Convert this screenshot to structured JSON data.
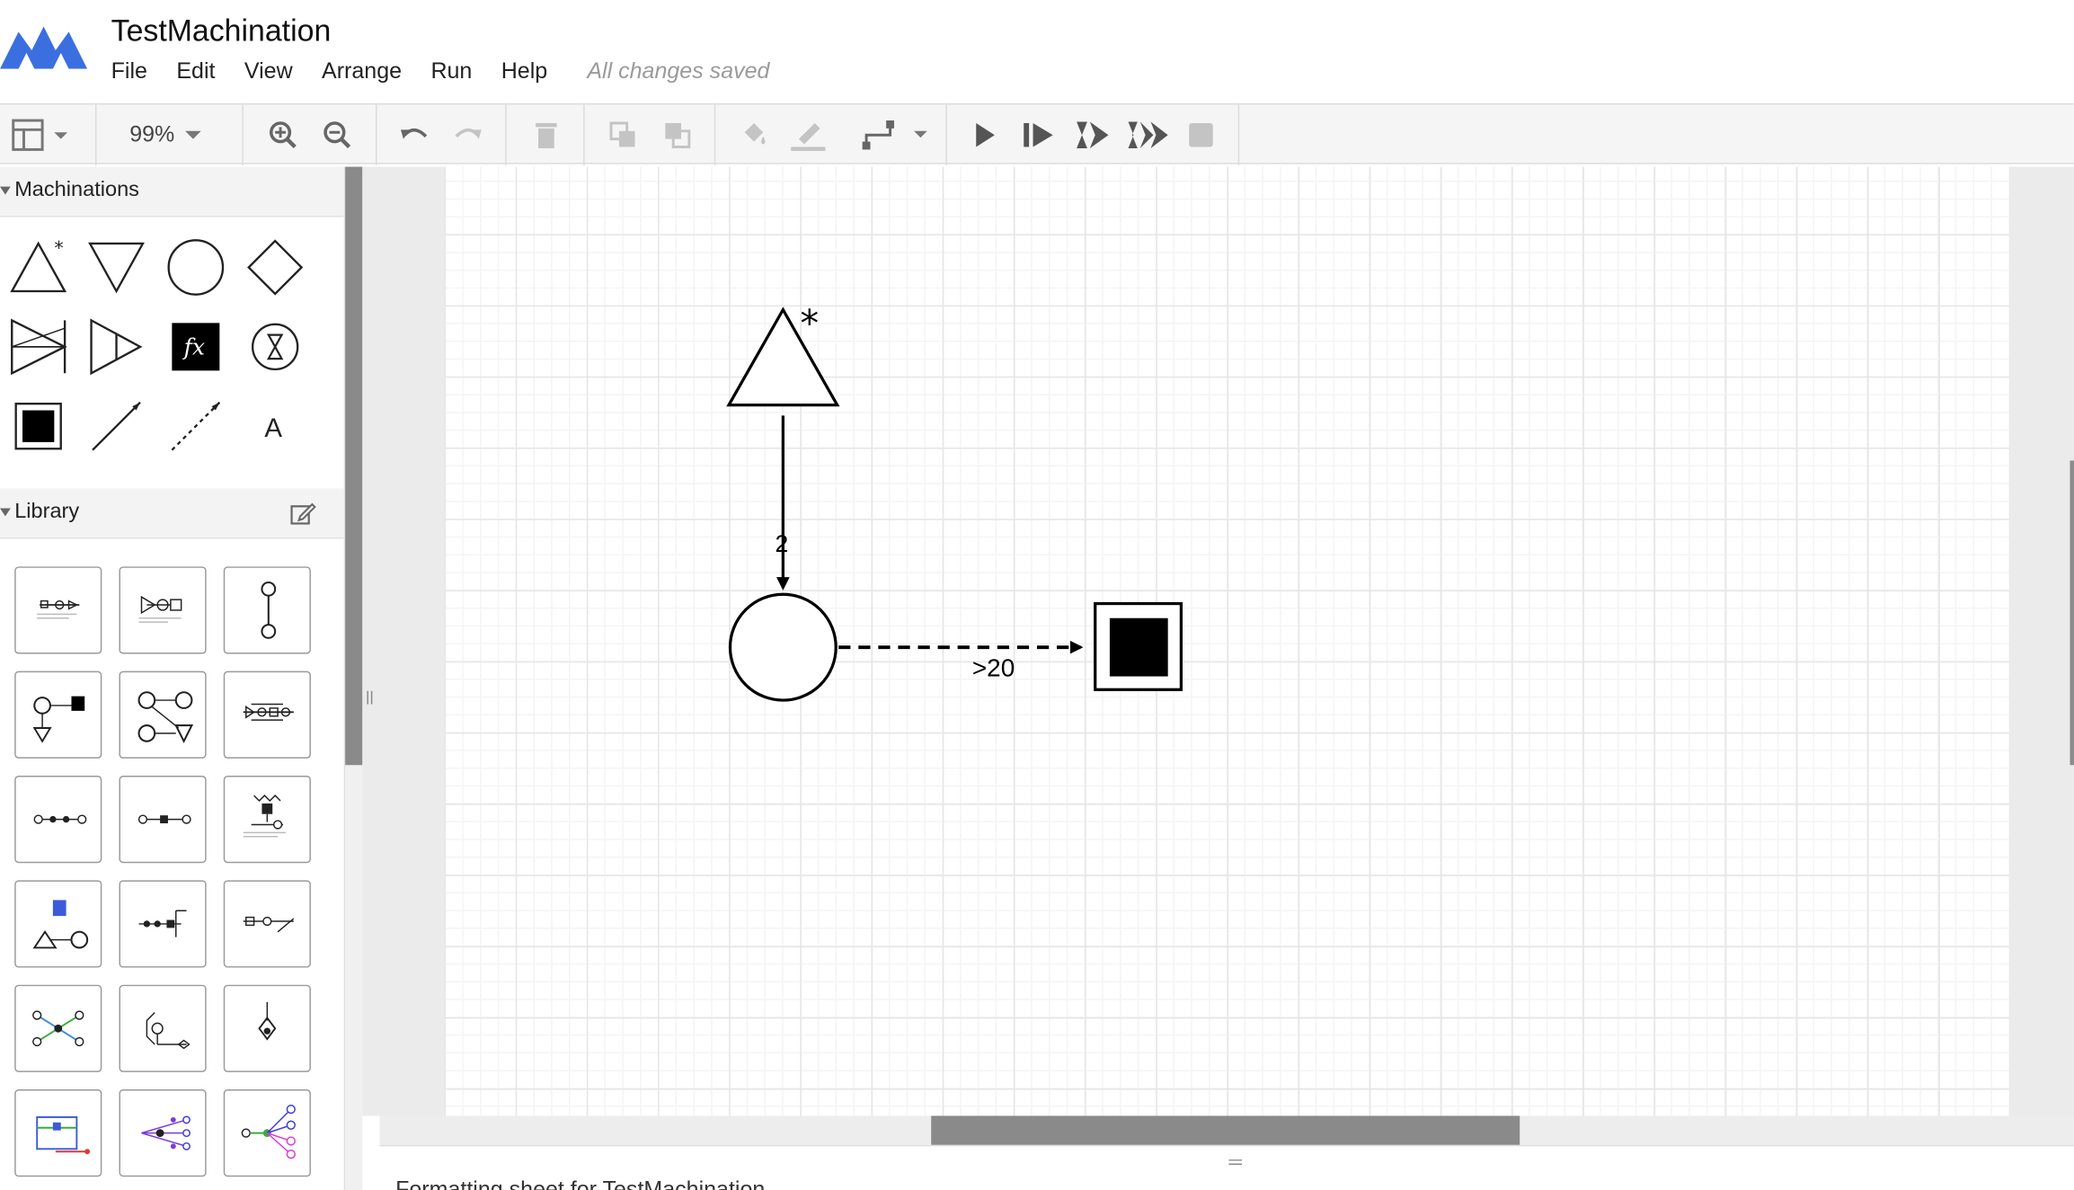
{
  "app": {
    "title": "TestMachination",
    "logo_icon": "machinations-logo-icon",
    "saved_status": "All changes saved"
  },
  "menu": [
    "File",
    "Edit",
    "View",
    "Arrange",
    "Run",
    "Help"
  ],
  "toolbar": {
    "zoom": "99%",
    "icons": [
      "format-panel-icon",
      "zoom-in-icon",
      "zoom-out-icon",
      "undo-icon",
      "redo-icon",
      "delete-icon",
      "to-front-icon",
      "to-back-icon",
      "fill-color-icon",
      "line-color-icon",
      "waypoints-icon",
      "play-icon",
      "step-icon",
      "quick-run-icon",
      "multiple-run-icon",
      "stop-icon"
    ]
  },
  "sidebar": {
    "machinations_title": "Machinations",
    "shapes": [
      "source",
      "drain",
      "pool",
      "gate",
      "converter",
      "trader",
      "register",
      "delay",
      "end-condition",
      "resource-connection",
      "state-connection",
      "text-label"
    ],
    "register_label": "fx",
    "text_label": "A",
    "library_title": "Library",
    "library_count": 18
  },
  "diagram": {
    "resource_connection_label": "2",
    "state_connection_label": ">20"
  },
  "bottom": {
    "format_label": "Formatting sheet for TestMachination"
  },
  "colors": {
    "logo": "#3b6fe0",
    "scroll_thumb": "#8a8a8a",
    "toolbar_bg": "#f5f5f5"
  }
}
